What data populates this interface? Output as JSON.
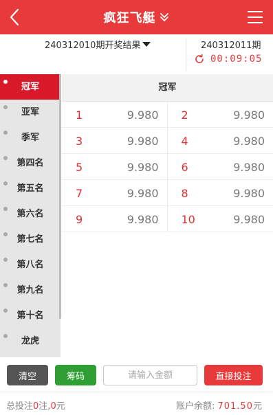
{
  "header": {
    "title": "疯狂飞艇"
  },
  "info": {
    "prev_result_label": "240312010期开奖结果",
    "next_issue": "240312011期",
    "countdown": "00:09:05"
  },
  "sidebar": {
    "items": [
      {
        "label": "冠军",
        "active": true
      },
      {
        "label": "亚军"
      },
      {
        "label": "季军"
      },
      {
        "label": "第四名"
      },
      {
        "label": "第五名"
      },
      {
        "label": "第六名"
      },
      {
        "label": "第七名"
      },
      {
        "label": "第八名"
      },
      {
        "label": "第九名"
      },
      {
        "label": "第十名"
      },
      {
        "label": "龙虎"
      }
    ]
  },
  "main": {
    "section_title": "冠军",
    "cells": [
      {
        "num": "1",
        "odds": "9.980"
      },
      {
        "num": "2",
        "odds": "9.980"
      },
      {
        "num": "3",
        "odds": "9.980"
      },
      {
        "num": "4",
        "odds": "9.980"
      },
      {
        "num": "5",
        "odds": "9.980"
      },
      {
        "num": "6",
        "odds": "9.980"
      },
      {
        "num": "7",
        "odds": "9.980"
      },
      {
        "num": "8",
        "odds": "9.980"
      },
      {
        "num": "9",
        "odds": "9.980"
      },
      {
        "num": "10",
        "odds": "9.980"
      }
    ]
  },
  "actions": {
    "clear_label": "清空",
    "chip_label": "筹码",
    "amount_placeholder": "请输入金额",
    "bet_label": "直接投注"
  },
  "footer": {
    "total_prefix": "总投注",
    "total_count": "0",
    "total_mid": "注,",
    "total_amount": "0",
    "total_suffix": "元",
    "balance_label": "账户余额:",
    "balance_value": "701.50",
    "balance_suffix": "元"
  },
  "colors": {
    "brand_red": "#e83a3a",
    "active_tab": "#d7192a",
    "chip_green": "#2f9f33",
    "clear_gray": "#555555"
  }
}
